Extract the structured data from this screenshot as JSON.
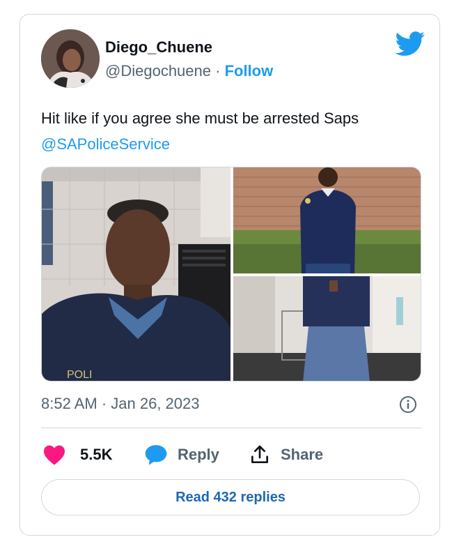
{
  "tweet": {
    "author_name": "Diego_Chuene",
    "handle": "@Diegochuene",
    "separator": " · ",
    "follow_label": "Follow",
    "text": "Hit like if you agree she must be arrested Saps",
    "mention": "@SAPoliceService",
    "timestamp": "8:52 AM · Jan 26, 2023"
  },
  "actions": {
    "like_count": "5.5K",
    "reply_label": "Reply",
    "share_label": "Share",
    "read_replies_label": "Read 432 replies"
  },
  "colors": {
    "accent": "#1d9bf0",
    "like": "#f91880",
    "text": "#0f1419",
    "muted": "#536471",
    "border": "#cfd9de"
  },
  "icons": [
    "twitter-bird-icon",
    "info-icon",
    "heart-icon",
    "reply-bubble-icon",
    "share-icon"
  ]
}
